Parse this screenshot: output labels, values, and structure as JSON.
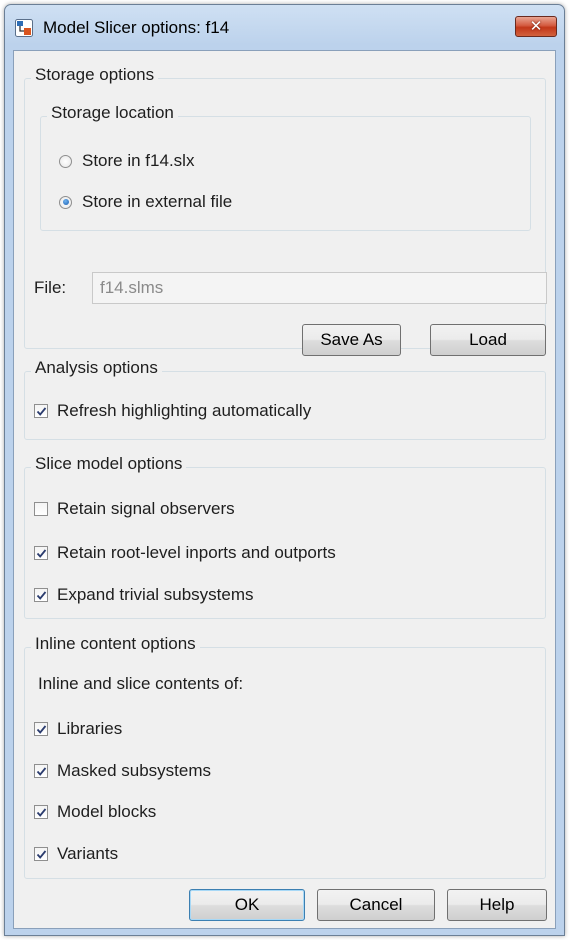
{
  "window": {
    "title": "Model Slicer options: f14",
    "close_label": "✕"
  },
  "storage": {
    "group_label": "Storage options",
    "location_label": "Storage location",
    "radio_slx": "Store in f14.slx",
    "radio_external": "Store in external file",
    "file_label": "File:",
    "file_value": "f14.slms",
    "save_as": "Save As",
    "load": "Load"
  },
  "analysis": {
    "group_label": "Analysis options",
    "refresh": "Refresh highlighting automatically"
  },
  "slice": {
    "group_label": "Slice model options",
    "retain_observers": "Retain signal observers",
    "retain_ports": "Retain root-level inports and outports",
    "expand_trivial": "Expand trivial subsystems"
  },
  "inline": {
    "group_label": "Inline content options",
    "subtitle": "Inline and slice contents of:",
    "libraries": "Libraries",
    "masked": "Masked subsystems",
    "model_blocks": "Model blocks",
    "variants": "Variants"
  },
  "footer": {
    "ok": "OK",
    "cancel": "Cancel",
    "help": "Help"
  }
}
